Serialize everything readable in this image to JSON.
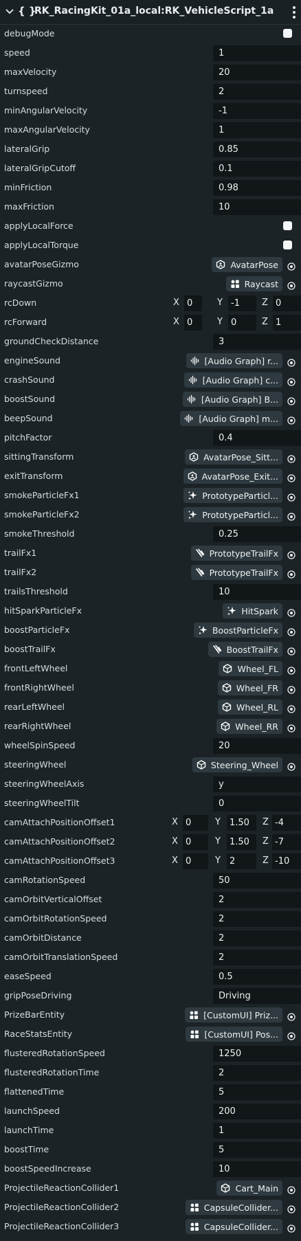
{
  "header": {
    "title": "RK_RacingKit_01a_local:RK_VehicleScript_1a",
    "braces": "{ }"
  },
  "rows": [
    {
      "label": "debugMode",
      "type": "toggle"
    },
    {
      "label": "speed",
      "type": "value",
      "value": "1"
    },
    {
      "label": "maxVelocity",
      "type": "value",
      "value": "20"
    },
    {
      "label": "turnspeed",
      "type": "value",
      "value": "2"
    },
    {
      "label": "minAngularVelocity",
      "type": "value",
      "value": "-1"
    },
    {
      "label": "maxAngularVelocity",
      "type": "value",
      "value": "1"
    },
    {
      "label": "lateralGrip",
      "type": "value",
      "value": "0.85"
    },
    {
      "label": "lateralGripCutoff",
      "type": "value",
      "value": "0.1"
    },
    {
      "label": "minFriction",
      "type": "value",
      "value": "0.98"
    },
    {
      "label": "maxFriction",
      "type": "value",
      "value": "10"
    },
    {
      "label": "applyLocalForce",
      "type": "toggle"
    },
    {
      "label": "applyLocalTorque",
      "type": "toggle"
    },
    {
      "label": "avatarPoseGizmo",
      "type": "ref",
      "value": "AvatarPose",
      "icon": "avatar-pose-icon"
    },
    {
      "label": "raycastGizmo",
      "type": "ref",
      "value": "Raycast",
      "icon": "gizmo-grid-icon"
    },
    {
      "label": "rcDown",
      "type": "vec3",
      "x": "0",
      "y": "-1",
      "z": "0",
      "variant": "short"
    },
    {
      "label": "rcForward",
      "type": "vec3",
      "x": "0",
      "y": "0",
      "z": "1",
      "variant": "short"
    },
    {
      "label": "groundCheckDistance",
      "type": "value",
      "value": "3"
    },
    {
      "label": "engineSound",
      "type": "ref",
      "value": "[Audio Graph] r...",
      "icon": "audio-waveform-icon"
    },
    {
      "label": "crashSound",
      "type": "ref",
      "value": "[Audio Graph] c...",
      "icon": "audio-waveform-icon"
    },
    {
      "label": "boostSound",
      "type": "ref",
      "value": "[Audio Graph] B...",
      "icon": "audio-waveform-icon"
    },
    {
      "label": "beepSound",
      "type": "ref",
      "value": "[Audio Graph] m...",
      "icon": "audio-waveform-icon"
    },
    {
      "label": "pitchFactor",
      "type": "value",
      "value": "0.4"
    },
    {
      "label": "sittingTransform",
      "type": "ref",
      "value": "AvatarPose_Sitt...",
      "icon": "avatar-pose-icon"
    },
    {
      "label": "exitTransform",
      "type": "ref",
      "value": "AvatarPose_Exit...",
      "icon": "avatar-pose-icon"
    },
    {
      "label": "smokeParticleFx1",
      "type": "ref",
      "value": "PrototypeParticl...",
      "icon": "sparkle-icon"
    },
    {
      "label": "smokeParticleFx2",
      "type": "ref",
      "value": "PrototypeParticl...",
      "icon": "sparkle-icon"
    },
    {
      "label": "smokeThreshold",
      "type": "value",
      "value": "0.25"
    },
    {
      "label": "trailFx1",
      "type": "ref",
      "value": "PrototypeTrailFx",
      "icon": "trail-icon"
    },
    {
      "label": "trailFx2",
      "type": "ref",
      "value": "PrototypeTrailFx",
      "icon": "trail-icon"
    },
    {
      "label": "trailsThreshold",
      "type": "value",
      "value": "10"
    },
    {
      "label": "hitSparkParticleFx",
      "type": "ref",
      "value": "HitSpark",
      "icon": "sparkle-icon"
    },
    {
      "label": "boostParticleFx",
      "type": "ref",
      "value": "BoostParticleFx",
      "icon": "sparkle-icon"
    },
    {
      "label": "boostTrailFx",
      "type": "ref",
      "value": "BoostTrailFx",
      "icon": "trail-icon"
    },
    {
      "label": "frontLeftWheel",
      "type": "ref",
      "value": "Wheel_FL",
      "icon": "mesh-icon"
    },
    {
      "label": "frontRightWheel",
      "type": "ref",
      "value": "Wheel_FR",
      "icon": "mesh-icon"
    },
    {
      "label": "rearLeftWheel",
      "type": "ref",
      "value": "Wheel_RL",
      "icon": "mesh-icon"
    },
    {
      "label": "rearRightWheel",
      "type": "ref",
      "value": "Wheel_RR",
      "icon": "mesh-icon"
    },
    {
      "label": "wheelSpinSpeed",
      "type": "value",
      "value": "20"
    },
    {
      "label": "steeringWheel",
      "type": "ref",
      "value": "Steering_Wheel",
      "icon": "mesh-icon"
    },
    {
      "label": "steeringWheelAxis",
      "type": "value",
      "value": "y"
    },
    {
      "label": "steeringWheelTilt",
      "type": "value",
      "value": "0"
    },
    {
      "label": "camAttachPositionOffset1",
      "type": "vec3",
      "x": "0",
      "y": "1.50",
      "z": "-4",
      "variant": "long"
    },
    {
      "label": "camAttachPositionOffset2",
      "type": "vec3",
      "x": "0",
      "y": "1.50",
      "z": "-7",
      "variant": "long"
    },
    {
      "label": "camAttachPositionOffset3",
      "type": "vec3",
      "x": "0",
      "y": "2",
      "z": "-10",
      "variant": "long"
    },
    {
      "label": "camRotationSpeed",
      "type": "value",
      "value": "50"
    },
    {
      "label": "camOrbitVerticalOffset",
      "type": "value",
      "value": "2"
    },
    {
      "label": "camOrbitRotationSpeed",
      "type": "value",
      "value": "2"
    },
    {
      "label": "camOrbitDistance",
      "type": "value",
      "value": "2"
    },
    {
      "label": "camOrbitTranslationSpeed",
      "type": "value",
      "value": "2"
    },
    {
      "label": "easeSpeed",
      "type": "value",
      "value": "0.5"
    },
    {
      "label": "gripPoseDriving",
      "type": "value",
      "value": "Driving"
    },
    {
      "label": "PrizeBarEntity",
      "type": "ref",
      "value": "[CustomUI] Priz...",
      "icon": "gizmo-grid-icon"
    },
    {
      "label": "RaceStatsEntity",
      "type": "ref",
      "value": "[CustomUI] Pos...",
      "icon": "gizmo-grid-icon"
    },
    {
      "label": "flusteredRotationSpeed",
      "type": "value",
      "value": "1250"
    },
    {
      "label": "flusteredRotationTime",
      "type": "value",
      "value": "2"
    },
    {
      "label": "flattenedTime",
      "type": "value",
      "value": "5"
    },
    {
      "label": "launchSpeed",
      "type": "value",
      "value": "200"
    },
    {
      "label": "launchTime",
      "type": "value",
      "value": "1"
    },
    {
      "label": "boostTime",
      "type": "value",
      "value": "5"
    },
    {
      "label": "boostSpeedIncrease",
      "type": "value",
      "value": "10"
    },
    {
      "label": "ProjectileReactionCollider1",
      "type": "ref",
      "value": "Cart_Main",
      "icon": "mesh-icon"
    },
    {
      "label": "ProjectileReactionCollider2",
      "type": "ref",
      "value": "CapsuleCollider...",
      "icon": "gizmo-grid-icon"
    },
    {
      "label": "ProjectileReactionCollider3",
      "type": "ref",
      "value": "CapsuleCollider...",
      "icon": "gizmo-grid-icon"
    }
  ]
}
